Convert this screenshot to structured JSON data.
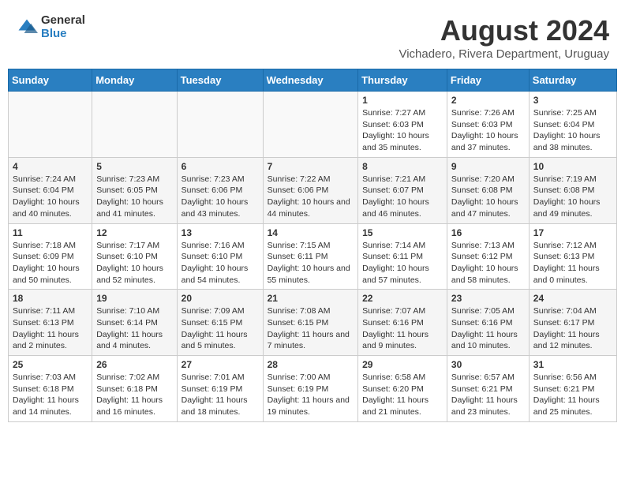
{
  "header": {
    "logo_general": "General",
    "logo_blue": "Blue",
    "title": "August 2024",
    "subtitle": "Vichadero, Rivera Department, Uruguay"
  },
  "calendar": {
    "weekdays": [
      "Sunday",
      "Monday",
      "Tuesday",
      "Wednesday",
      "Thursday",
      "Friday",
      "Saturday"
    ],
    "weeks": [
      [
        {
          "day": "",
          "empty": true
        },
        {
          "day": "",
          "empty": true
        },
        {
          "day": "",
          "empty": true
        },
        {
          "day": "",
          "empty": true
        },
        {
          "day": "1",
          "sunrise": "7:27 AM",
          "sunset": "6:03 PM",
          "daylight": "10 hours and 35 minutes."
        },
        {
          "day": "2",
          "sunrise": "7:26 AM",
          "sunset": "6:03 PM",
          "daylight": "10 hours and 37 minutes."
        },
        {
          "day": "3",
          "sunrise": "7:25 AM",
          "sunset": "6:04 PM",
          "daylight": "10 hours and 38 minutes."
        }
      ],
      [
        {
          "day": "4",
          "sunrise": "7:24 AM",
          "sunset": "6:04 PM",
          "daylight": "10 hours and 40 minutes."
        },
        {
          "day": "5",
          "sunrise": "7:23 AM",
          "sunset": "6:05 PM",
          "daylight": "10 hours and 41 minutes."
        },
        {
          "day": "6",
          "sunrise": "7:23 AM",
          "sunset": "6:06 PM",
          "daylight": "10 hours and 43 minutes."
        },
        {
          "day": "7",
          "sunrise": "7:22 AM",
          "sunset": "6:06 PM",
          "daylight": "10 hours and 44 minutes."
        },
        {
          "day": "8",
          "sunrise": "7:21 AM",
          "sunset": "6:07 PM",
          "daylight": "10 hours and 46 minutes."
        },
        {
          "day": "9",
          "sunrise": "7:20 AM",
          "sunset": "6:08 PM",
          "daylight": "10 hours and 47 minutes."
        },
        {
          "day": "10",
          "sunrise": "7:19 AM",
          "sunset": "6:08 PM",
          "daylight": "10 hours and 49 minutes."
        }
      ],
      [
        {
          "day": "11",
          "sunrise": "7:18 AM",
          "sunset": "6:09 PM",
          "daylight": "10 hours and 50 minutes."
        },
        {
          "day": "12",
          "sunrise": "7:17 AM",
          "sunset": "6:10 PM",
          "daylight": "10 hours and 52 minutes."
        },
        {
          "day": "13",
          "sunrise": "7:16 AM",
          "sunset": "6:10 PM",
          "daylight": "10 hours and 54 minutes."
        },
        {
          "day": "14",
          "sunrise": "7:15 AM",
          "sunset": "6:11 PM",
          "daylight": "10 hours and 55 minutes."
        },
        {
          "day": "15",
          "sunrise": "7:14 AM",
          "sunset": "6:11 PM",
          "daylight": "10 hours and 57 minutes."
        },
        {
          "day": "16",
          "sunrise": "7:13 AM",
          "sunset": "6:12 PM",
          "daylight": "10 hours and 58 minutes."
        },
        {
          "day": "17",
          "sunrise": "7:12 AM",
          "sunset": "6:13 PM",
          "daylight": "11 hours and 0 minutes."
        }
      ],
      [
        {
          "day": "18",
          "sunrise": "7:11 AM",
          "sunset": "6:13 PM",
          "daylight": "11 hours and 2 minutes."
        },
        {
          "day": "19",
          "sunrise": "7:10 AM",
          "sunset": "6:14 PM",
          "daylight": "11 hours and 4 minutes."
        },
        {
          "day": "20",
          "sunrise": "7:09 AM",
          "sunset": "6:15 PM",
          "daylight": "11 hours and 5 minutes."
        },
        {
          "day": "21",
          "sunrise": "7:08 AM",
          "sunset": "6:15 PM",
          "daylight": "11 hours and 7 minutes."
        },
        {
          "day": "22",
          "sunrise": "7:07 AM",
          "sunset": "6:16 PM",
          "daylight": "11 hours and 9 minutes."
        },
        {
          "day": "23",
          "sunrise": "7:05 AM",
          "sunset": "6:16 PM",
          "daylight": "11 hours and 10 minutes."
        },
        {
          "day": "24",
          "sunrise": "7:04 AM",
          "sunset": "6:17 PM",
          "daylight": "11 hours and 12 minutes."
        }
      ],
      [
        {
          "day": "25",
          "sunrise": "7:03 AM",
          "sunset": "6:18 PM",
          "daylight": "11 hours and 14 minutes."
        },
        {
          "day": "26",
          "sunrise": "7:02 AM",
          "sunset": "6:18 PM",
          "daylight": "11 hours and 16 minutes."
        },
        {
          "day": "27",
          "sunrise": "7:01 AM",
          "sunset": "6:19 PM",
          "daylight": "11 hours and 18 minutes."
        },
        {
          "day": "28",
          "sunrise": "7:00 AM",
          "sunset": "6:19 PM",
          "daylight": "11 hours and 19 minutes."
        },
        {
          "day": "29",
          "sunrise": "6:58 AM",
          "sunset": "6:20 PM",
          "daylight": "11 hours and 21 minutes."
        },
        {
          "day": "30",
          "sunrise": "6:57 AM",
          "sunset": "6:21 PM",
          "daylight": "11 hours and 23 minutes."
        },
        {
          "day": "31",
          "sunrise": "6:56 AM",
          "sunset": "6:21 PM",
          "daylight": "11 hours and 25 minutes."
        }
      ]
    ]
  }
}
